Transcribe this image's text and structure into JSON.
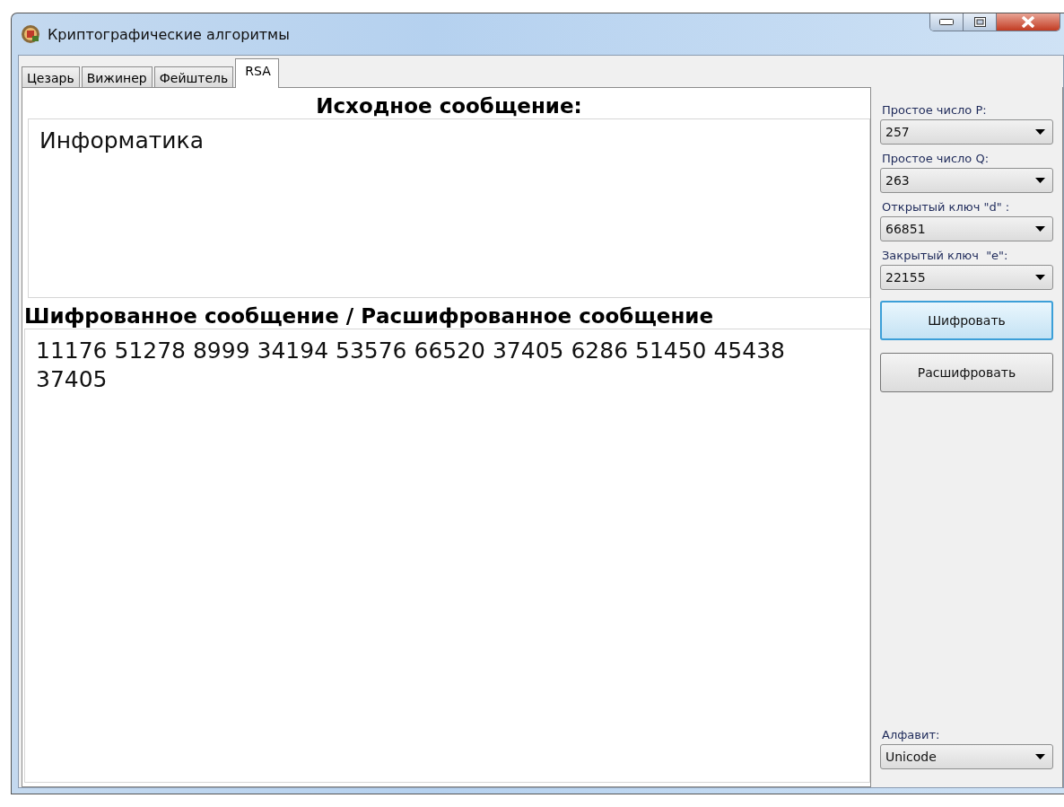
{
  "window": {
    "title": "Криптографические алгоритмы"
  },
  "tabs": [
    {
      "label": "Цезарь",
      "selected": false
    },
    {
      "label": "Вижинер",
      "selected": false
    },
    {
      "label": "Фейштель",
      "selected": false
    },
    {
      "label": "RSA",
      "selected": true
    }
  ],
  "source": {
    "heading": "Исходное сообщение:",
    "value": "Информатика"
  },
  "result": {
    "heading": "Шифрованное сообщение / Расшифрованное сообщение",
    "value": "11176 51278 8999 34194 53576 66520 37405 6286 51450 45438 37405"
  },
  "params": [
    {
      "label": "Простое число P:",
      "value": "257"
    },
    {
      "label": "Простое число Q:",
      "value": "263"
    },
    {
      "label": "Открытый ключ \"d\" :",
      "value": "66851"
    },
    {
      "label": "Закрытый ключ  \"e\":",
      "value": "22155"
    }
  ],
  "buttons": [
    {
      "label": "Шифровать",
      "focused": true
    },
    {
      "label": "Расшифровать",
      "focused": false
    }
  ],
  "alphabet": {
    "label": "Алфавит:",
    "value": "Unicode"
  }
}
